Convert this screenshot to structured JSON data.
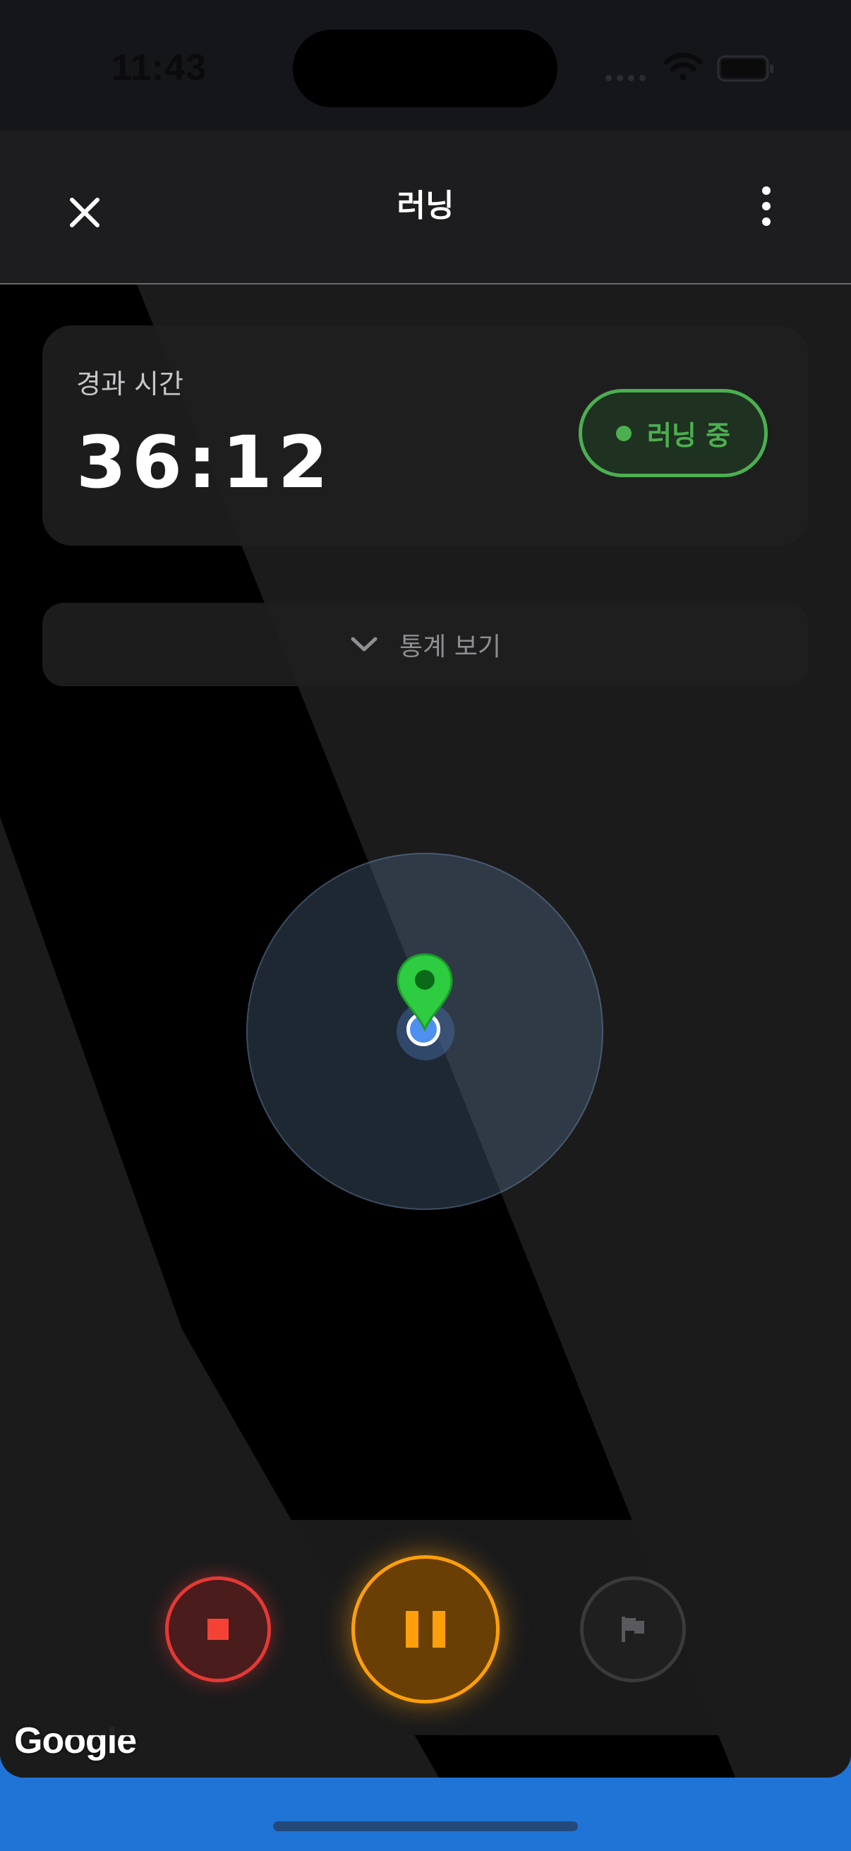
{
  "status_bar": {
    "time": "11:43"
  },
  "header": {
    "title": "러닝",
    "close_icon": "close-icon",
    "more_icon": "more-vertical-icon"
  },
  "timer_card": {
    "label": "경과 시간",
    "value": "36:12",
    "badge": "러닝 중"
  },
  "stats_toggle": {
    "label": "통계 보기",
    "icon": "chevron-down-icon"
  },
  "map": {
    "attribution": "Google"
  },
  "controls": {
    "stop_icon": "stop-icon",
    "pause_icon": "pause-icon",
    "lap_icon": "flag-icon"
  },
  "colors": {
    "accent_green": "#4caf50",
    "stop_red": "#e53935",
    "pause_orange": "#ff9f0a",
    "bottom_blue": "#1f74d6"
  }
}
